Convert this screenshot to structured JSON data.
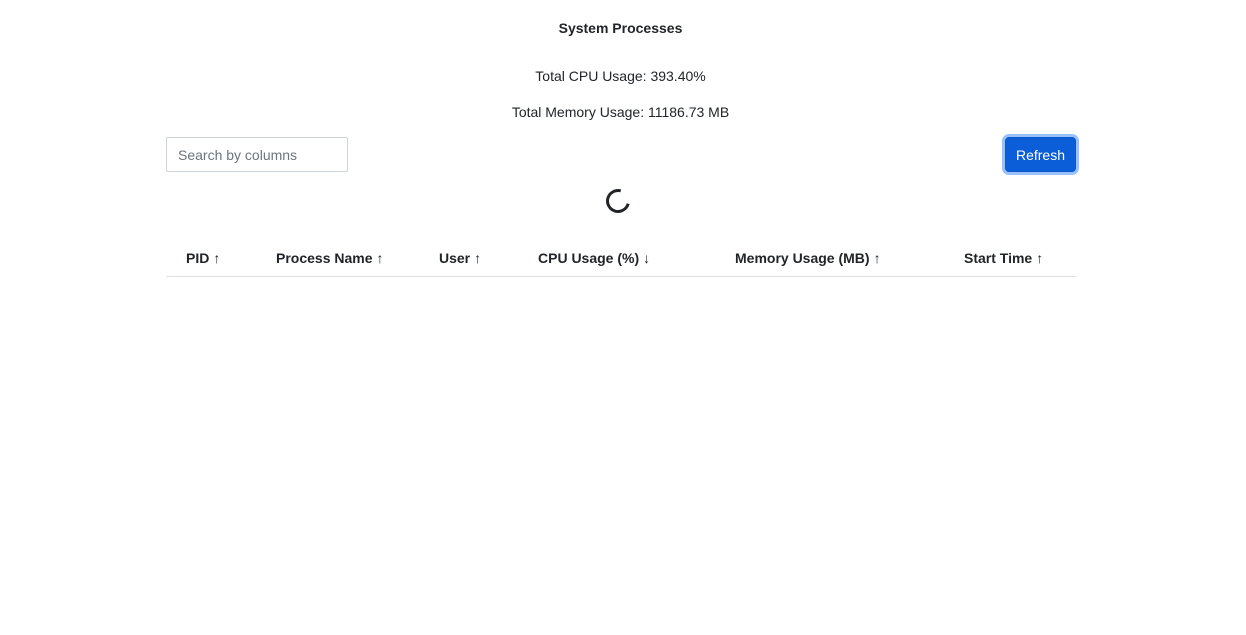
{
  "header": {
    "title": "System Processes",
    "total_cpu": "Total CPU Usage: 393.40%",
    "total_memory": "Total Memory Usage: 11186.73 MB"
  },
  "toolbar": {
    "search_placeholder": "Search by columns",
    "search_value": "",
    "refresh_label": "Refresh"
  },
  "table": {
    "columns": [
      {
        "label": "PID",
        "sort_arrow": "↑"
      },
      {
        "label": "Process Name",
        "sort_arrow": "↑"
      },
      {
        "label": "User",
        "sort_arrow": "↑"
      },
      {
        "label": "CPU Usage (%)",
        "sort_arrow": "↓"
      },
      {
        "label": "Memory Usage (MB)",
        "sort_arrow": "↑"
      },
      {
        "label": "Start Time",
        "sort_arrow": "↑"
      }
    ],
    "rows": []
  },
  "colors": {
    "accent": "#0b5ed7",
    "text": "#212529",
    "border": "#dee2e6"
  }
}
